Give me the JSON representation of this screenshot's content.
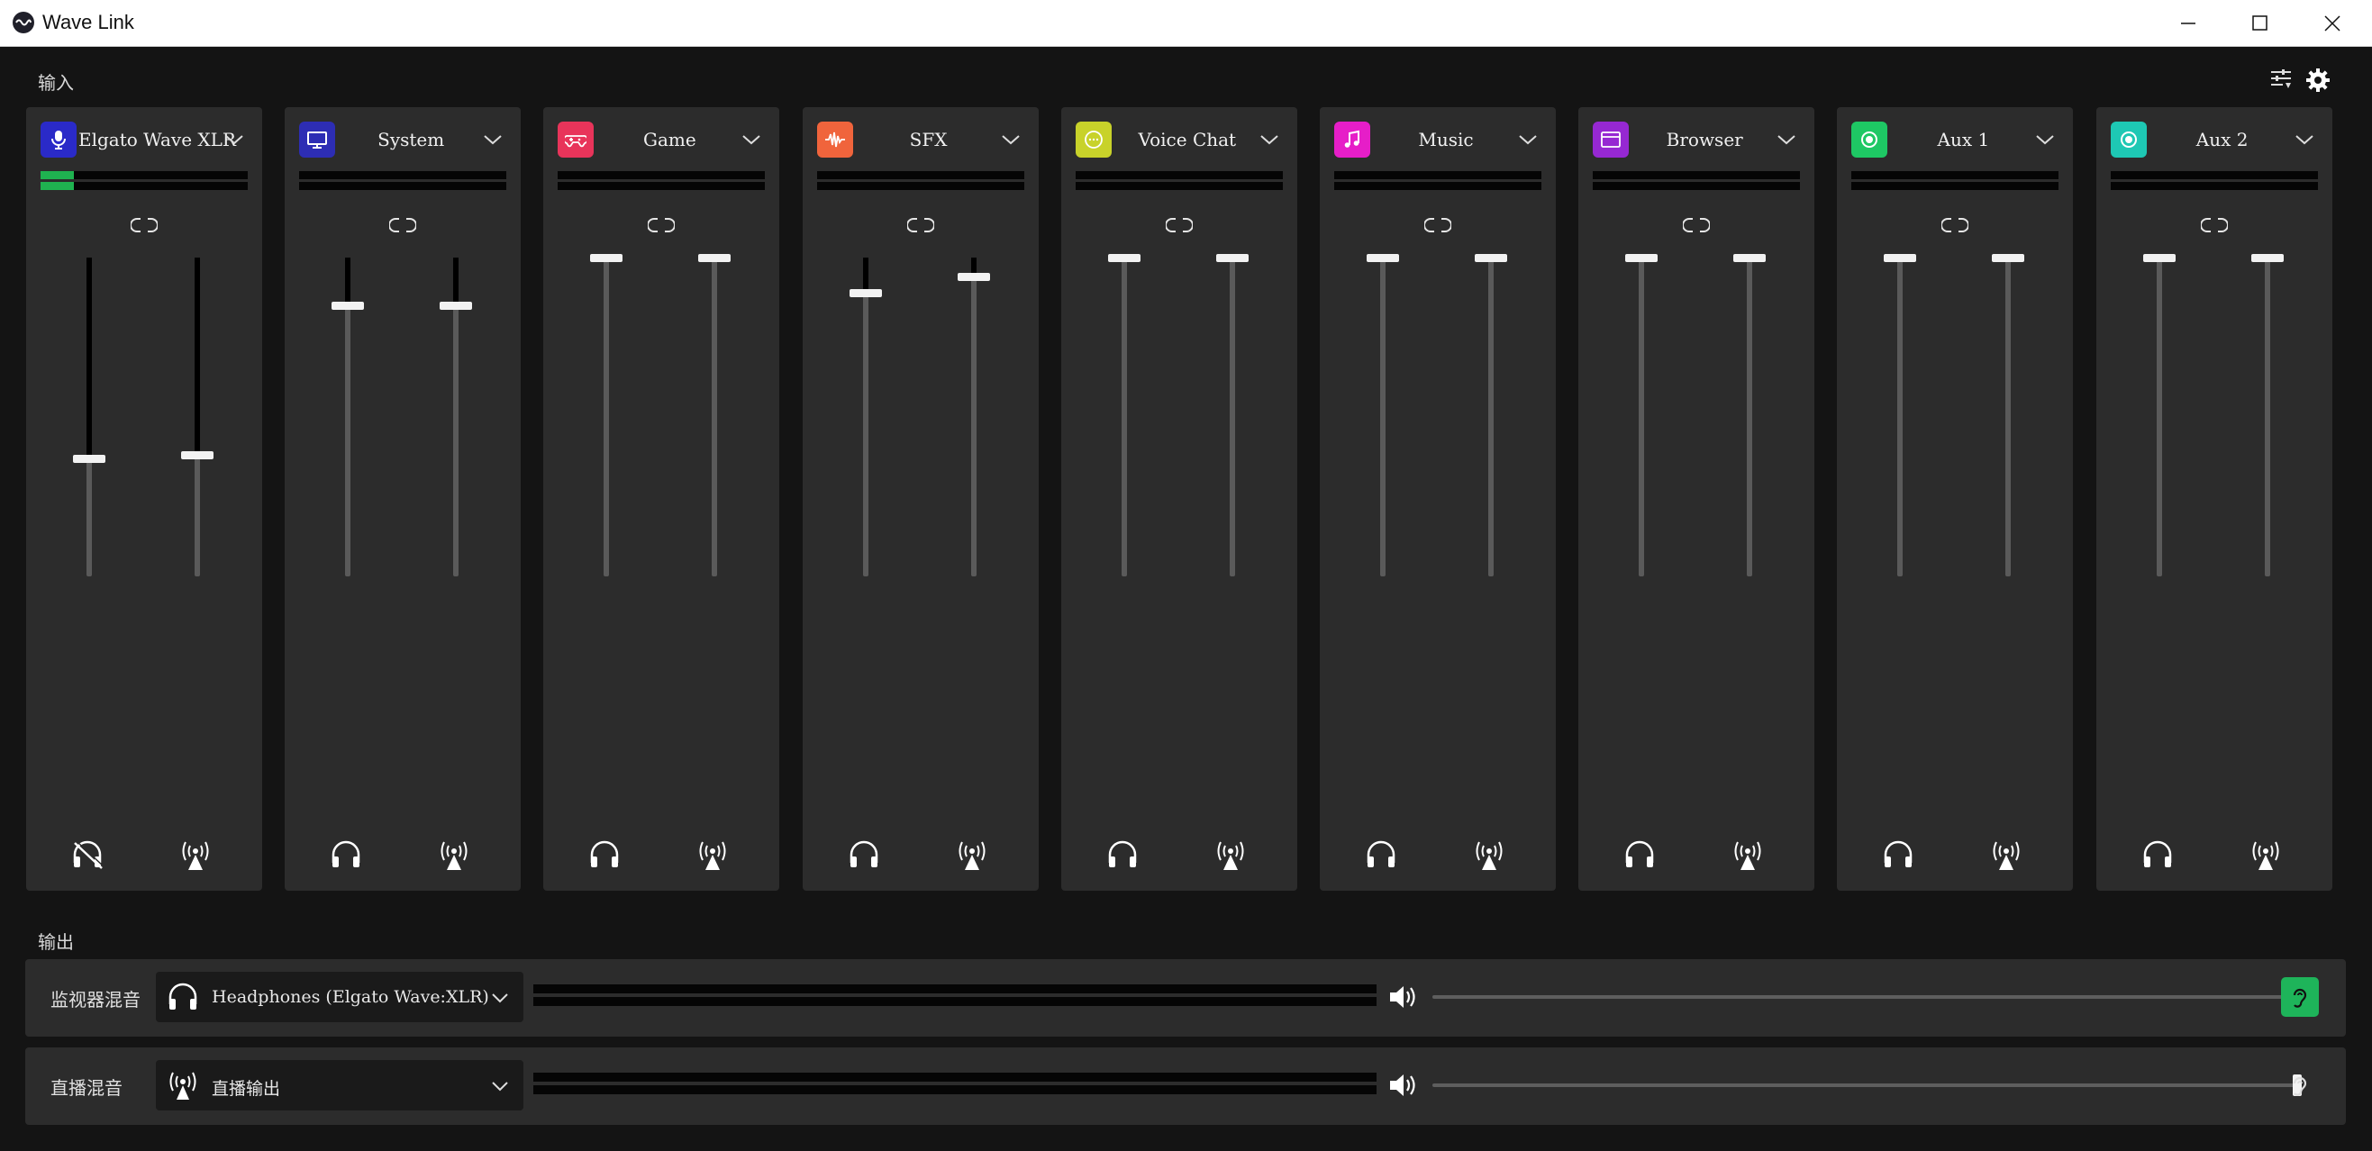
{
  "window": {
    "title": "Wave Link"
  },
  "inputs_label": "输入",
  "outputs_label": "输出",
  "channels": [
    {
      "name": "Elgato Wave XLR",
      "icon": "microphone-icon",
      "color": "#2a2ac8",
      "fader_left": 0.37,
      "fader_right": 0.38,
      "meter_level": 0.16,
      "left_icon": "headphones-muted-icon"
    },
    {
      "name": "System",
      "icon": "monitor-icon",
      "color": "#2d2db4",
      "fader_left": 0.85,
      "fader_right": 0.85,
      "meter_level": 0,
      "left_icon": "headphones-icon"
    },
    {
      "name": "Game",
      "icon": "gamepad-icon",
      "color": "#e8345a",
      "fader_left": 1.0,
      "fader_right": 1.0,
      "meter_level": 0,
      "left_icon": "headphones-icon"
    },
    {
      "name": "SFX",
      "icon": "waveform-icon",
      "color": "#f0643c",
      "fader_left": 0.89,
      "fader_right": 0.94,
      "meter_level": 0,
      "left_icon": "headphones-icon"
    },
    {
      "name": "Voice Chat",
      "icon": "chat-bubble-icon",
      "color": "#c8d22a",
      "fader_left": 1.0,
      "fader_right": 1.0,
      "meter_level": 0,
      "left_icon": "headphones-icon"
    },
    {
      "name": "Music",
      "icon": "music-note-icon",
      "color": "#e61ec8",
      "fader_left": 1.0,
      "fader_right": 1.0,
      "meter_level": 0,
      "left_icon": "headphones-icon"
    },
    {
      "name": "Browser",
      "icon": "browser-window-icon",
      "color": "#9628d2",
      "fader_left": 1.0,
      "fader_right": 1.0,
      "meter_level": 0,
      "left_icon": "headphones-icon"
    },
    {
      "name": "Aux 1",
      "icon": "aux-icon",
      "color": "#1ec864",
      "fader_left": 1.0,
      "fader_right": 1.0,
      "meter_level": 0,
      "left_icon": "headphones-icon"
    },
    {
      "name": "Aux 2",
      "icon": "aux-icon",
      "color": "#1ec8b4",
      "fader_left": 1.0,
      "fader_right": 1.0,
      "meter_level": 0,
      "left_icon": "headphones-icon"
    }
  ],
  "outputs": {
    "monitor": {
      "label": "监视器混音",
      "device": "Headphones (Elgato Wave:XLR)",
      "device_icon": "headphones-icon",
      "volume": 1.0,
      "listen_active": true,
      "listen_color": "#1eb45a"
    },
    "stream": {
      "label": "直播混音",
      "device": "直播输出",
      "device_icon": "broadcast-icon",
      "volume": 1.0,
      "listen_active": false
    }
  }
}
